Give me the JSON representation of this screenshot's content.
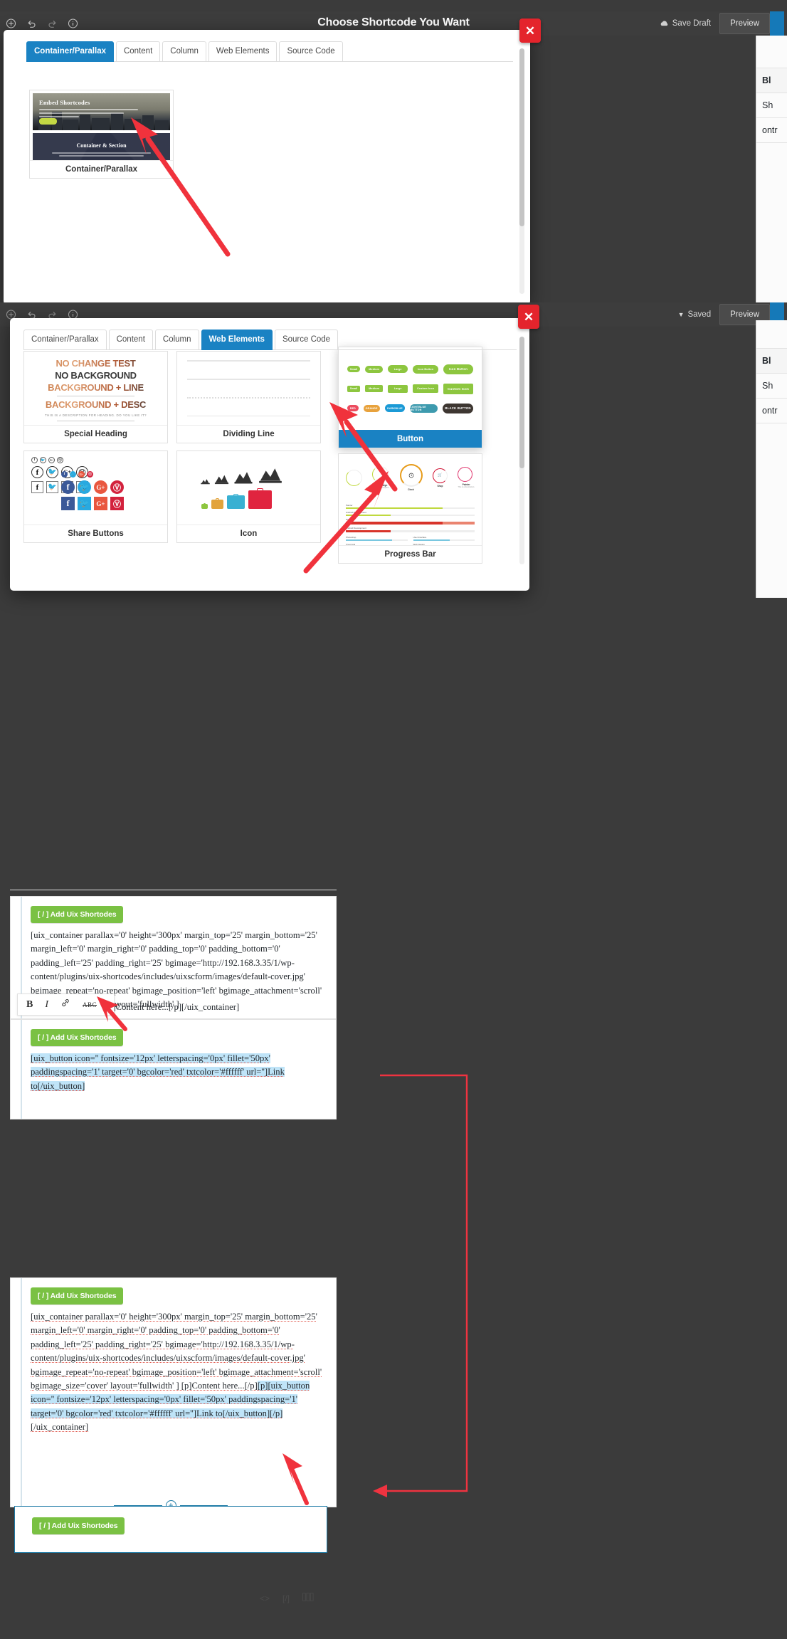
{
  "adminbar": {
    "title": "Choose Shortcode You Want",
    "save_draft": "Save Draft",
    "saved": "Saved",
    "preview": "Preview",
    "icons": [
      "add-icon",
      "undo-icon",
      "redo-icon",
      "info-icon"
    ]
  },
  "modal_top": {
    "tabs": [
      {
        "label": "Container/Parallax",
        "active": true
      },
      {
        "label": "Content",
        "active": false
      },
      {
        "label": "Column",
        "active": false
      },
      {
        "label": "Web Elements",
        "active": false
      },
      {
        "label": "Source Code",
        "active": false
      }
    ],
    "card": {
      "label": "Container/Parallax",
      "hero_title": "Embed Shortcodes",
      "section_title": "Container & Section"
    }
  },
  "modal_bottom": {
    "tabs": [
      {
        "label": "Container/Parallax",
        "active": false
      },
      {
        "label": "Content",
        "active": false
      },
      {
        "label": "Column",
        "active": false
      },
      {
        "label": "Web Elements",
        "active": true
      },
      {
        "label": "Source Code",
        "active": false
      }
    ],
    "cards": [
      {
        "label": "Special Heading",
        "selected": false
      },
      {
        "label": "Dividing Line",
        "selected": false
      },
      {
        "label": "Button",
        "selected": true
      },
      {
        "label": "Share Buttons",
        "selected": false
      },
      {
        "label": "Icon",
        "selected": false
      },
      {
        "label": "Progress Bar",
        "selected": false
      }
    ],
    "special_heading": {
      "line1": "NO CHANGE TEST",
      "line2": "NO BACKGROUND",
      "line3": "BACKGROUND + LINE",
      "line4": "BACKGROUND + DESC",
      "desc": "THIS IS A DESCRIPTION FOR HEADING. DO YOU LIKE IT?"
    },
    "button_preview": {
      "row1": [
        "Small",
        "Medium",
        "Large",
        "Icon Button",
        "Icon Button"
      ],
      "row2": [
        "Small",
        "Medium",
        "Large",
        "Custom Icon",
        "Custom Icon"
      ],
      "row3": [
        "RED",
        "ORANGE",
        "DARKBLUE",
        "LIGHTBLUE BUTTON",
        "BLACK BUTTON"
      ]
    },
    "share_buttons": {
      "networks": [
        "facebook-icon",
        "twitter-icon",
        "googleplus-icon",
        "pinterest-icon"
      ],
      "glyphs": [
        "f",
        "🐦",
        "G+",
        "Ⓟ"
      ]
    },
    "progress_preview": {
      "ring_labels": [
        "75%",
        "55%",
        "",
        "",
        "100%"
      ],
      "ring_captions": [
        "",
        "Web Design",
        "Clock",
        "Shop",
        "Painter"
      ],
      "ring_sub": [
        "",
        "This is a description.",
        "",
        "",
        "This is a description."
      ],
      "bars": [
        {
          "label": "Painter",
          "value": "75%"
        },
        {
          "label": "Android Development",
          "value": "35%"
        },
        {
          "label": "Painter",
          "value": "75%"
        },
        {
          "label": "Android Development",
          "value": "35%"
        }
      ],
      "bars2": [
        {
          "label": "Photoshop",
          "value": "75%"
        },
        {
          "label": "Front End",
          "value": "20%",
          "sub": "This is a description."
        },
        {
          "label": "Clock",
          "value": "?"
        },
        {
          "label": "User Interface",
          "value": "60%"
        },
        {
          "label": "Web Design",
          "value": "20%",
          "sub": "This is a description."
        },
        {
          "label": "Shop",
          "value": "?"
        }
      ]
    }
  },
  "right_panel": {
    "rows": [
      "Bl",
      "Sh",
      "ontr"
    ]
  },
  "editor": {
    "shortcode_button_label": "[ / ] Add Uix Shortodes",
    "format_toolbar": {
      "bold": "B",
      "italic": "I",
      "link": "link-icon",
      "strikethrough": "ABC"
    },
    "block1_code_a": "[uix_container parallax='0' height='300px' margin_top='25' margin_bottom='25' margin_left='0' margin_right='0' padding_top='0' padding_bottom='0' padding_left='25' padding_right='25' bgimage='http://192.168.3.35/1/wp-content/plugins/uix-shortcodes/includes/uixscform/images/default-cover.jpg' bgimage_repeat='no-repeat' bgimage_position='left' bgimage_attachment='scroll' bgimage_size='cover' layout='fullwidth' ]",
    "block1_code_b": "[p]Content here...[/p][/uix_container]",
    "block2_code": "[uix_button icon='' fontsize='12px' letterspacing='0px' fillet='50px' paddingspacing='1' target='0' bgcolor='red' txtcolor='#ffffff' url='']Link to[/uix_button]",
    "block3_code_plain": "[uix_container parallax='0' height='300px' margin_top='25' margin_bottom='25' margin_left='0' margin_right='0' padding_top='0' padding_bottom='0' padding_left='25' padding_right='25' bgimage='http://192.168.3.35/1/wp-content/plugins/uix-shortcodes/includes/uixscform/images/default-cover.jpg' bgimage_repeat='no-repeat' bgimage_position='left' bgimage_attachment='scroll' bgimage_size='cover' layout='fullwidth' ] [p]Content here...[/p]",
    "block3_code_hl": "[p][uix_button icon='' fontsize='12px' letterspacing='0px' fillet='50px' paddingspacing='1' target='0' bgcolor='red' txtcolor='#ffffff' url='']Link to[/uix_button][/p]",
    "block3_code_tail": "[/uix_container]",
    "footer_icons": [
      "code-icon",
      "shortcode-icon",
      "columns-icon"
    ],
    "footer_labels": [
      "<>",
      "[/]",
      "▐▐▐"
    ]
  },
  "colors": {
    "accent_blue": "#1a82c3",
    "green": "#7ac143",
    "red": "#e4242c",
    "highlight": "#bfe4f8"
  }
}
